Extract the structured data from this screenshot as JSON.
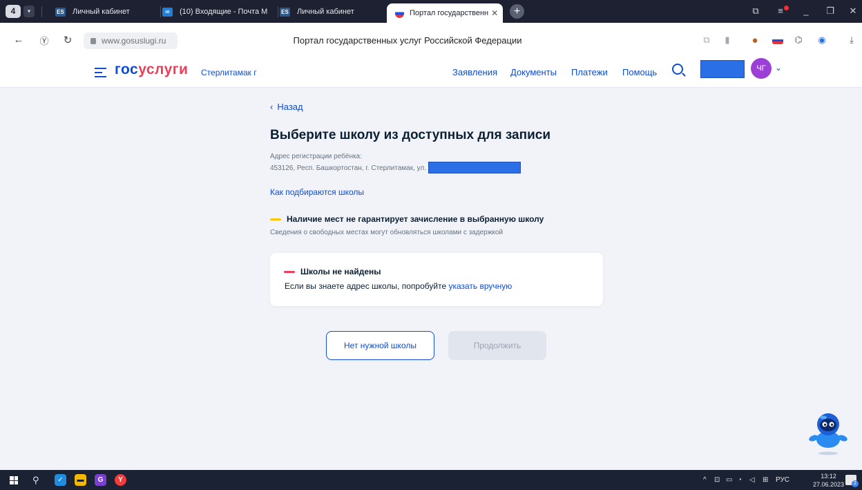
{
  "browser": {
    "tabs": [
      {
        "title": "Личный кабинет",
        "favicon": "es-favicon"
      },
      {
        "title": "(10) Входящие - Почта M",
        "favicon": "mail-favicon"
      },
      {
        "title": "Личный кабинет",
        "favicon": "es-favicon"
      },
      {
        "title": "Портал государственн",
        "favicon": "russia-flag-favicon",
        "active": true
      }
    ],
    "tab_counter": "4",
    "url": "www.gosuslugi.ru",
    "page_title": "Портал государственных услуг Российской Федерации"
  },
  "header": {
    "logo_part1": "гос",
    "logo_part2": "услуги",
    "city": "Стерлитамак г",
    "nav": [
      "Заявления",
      "Документы",
      "Платежи",
      "Помощь"
    ],
    "avatar_initials": "ЧГ"
  },
  "main": {
    "back_label": "Назад",
    "title": "Выберите школу из доступных для записи",
    "address_label": "Адрес регистрации ребёнка:",
    "address_value": "453126, Респ. Башкортостан, г. Стерлитамак, ул.",
    "how_link": "Как подбираются школы",
    "warning_title": "Наличие мест не гарантирует зачисление в выбранную школу",
    "warning_text": "Сведения о свободных местах могут обновляться школами с задержкой",
    "result_title": "Школы не найдены",
    "result_text": "Если вы знаете адрес школы, попробуйте ",
    "result_link": "указать вручную",
    "btn_no_school": "Нет нужной школы",
    "btn_continue": "Продолжить"
  },
  "taskbar": {
    "lang": "РУС",
    "time": "13:12",
    "date": "27.06.2023",
    "notif_count": "2"
  },
  "colors": {
    "primary": "#0d4cd3",
    "brand_red": "#ee3f58",
    "warning_yellow": "#ffc500",
    "page_bg": "#f1f3f9",
    "avatar": "#9c3fd6"
  }
}
